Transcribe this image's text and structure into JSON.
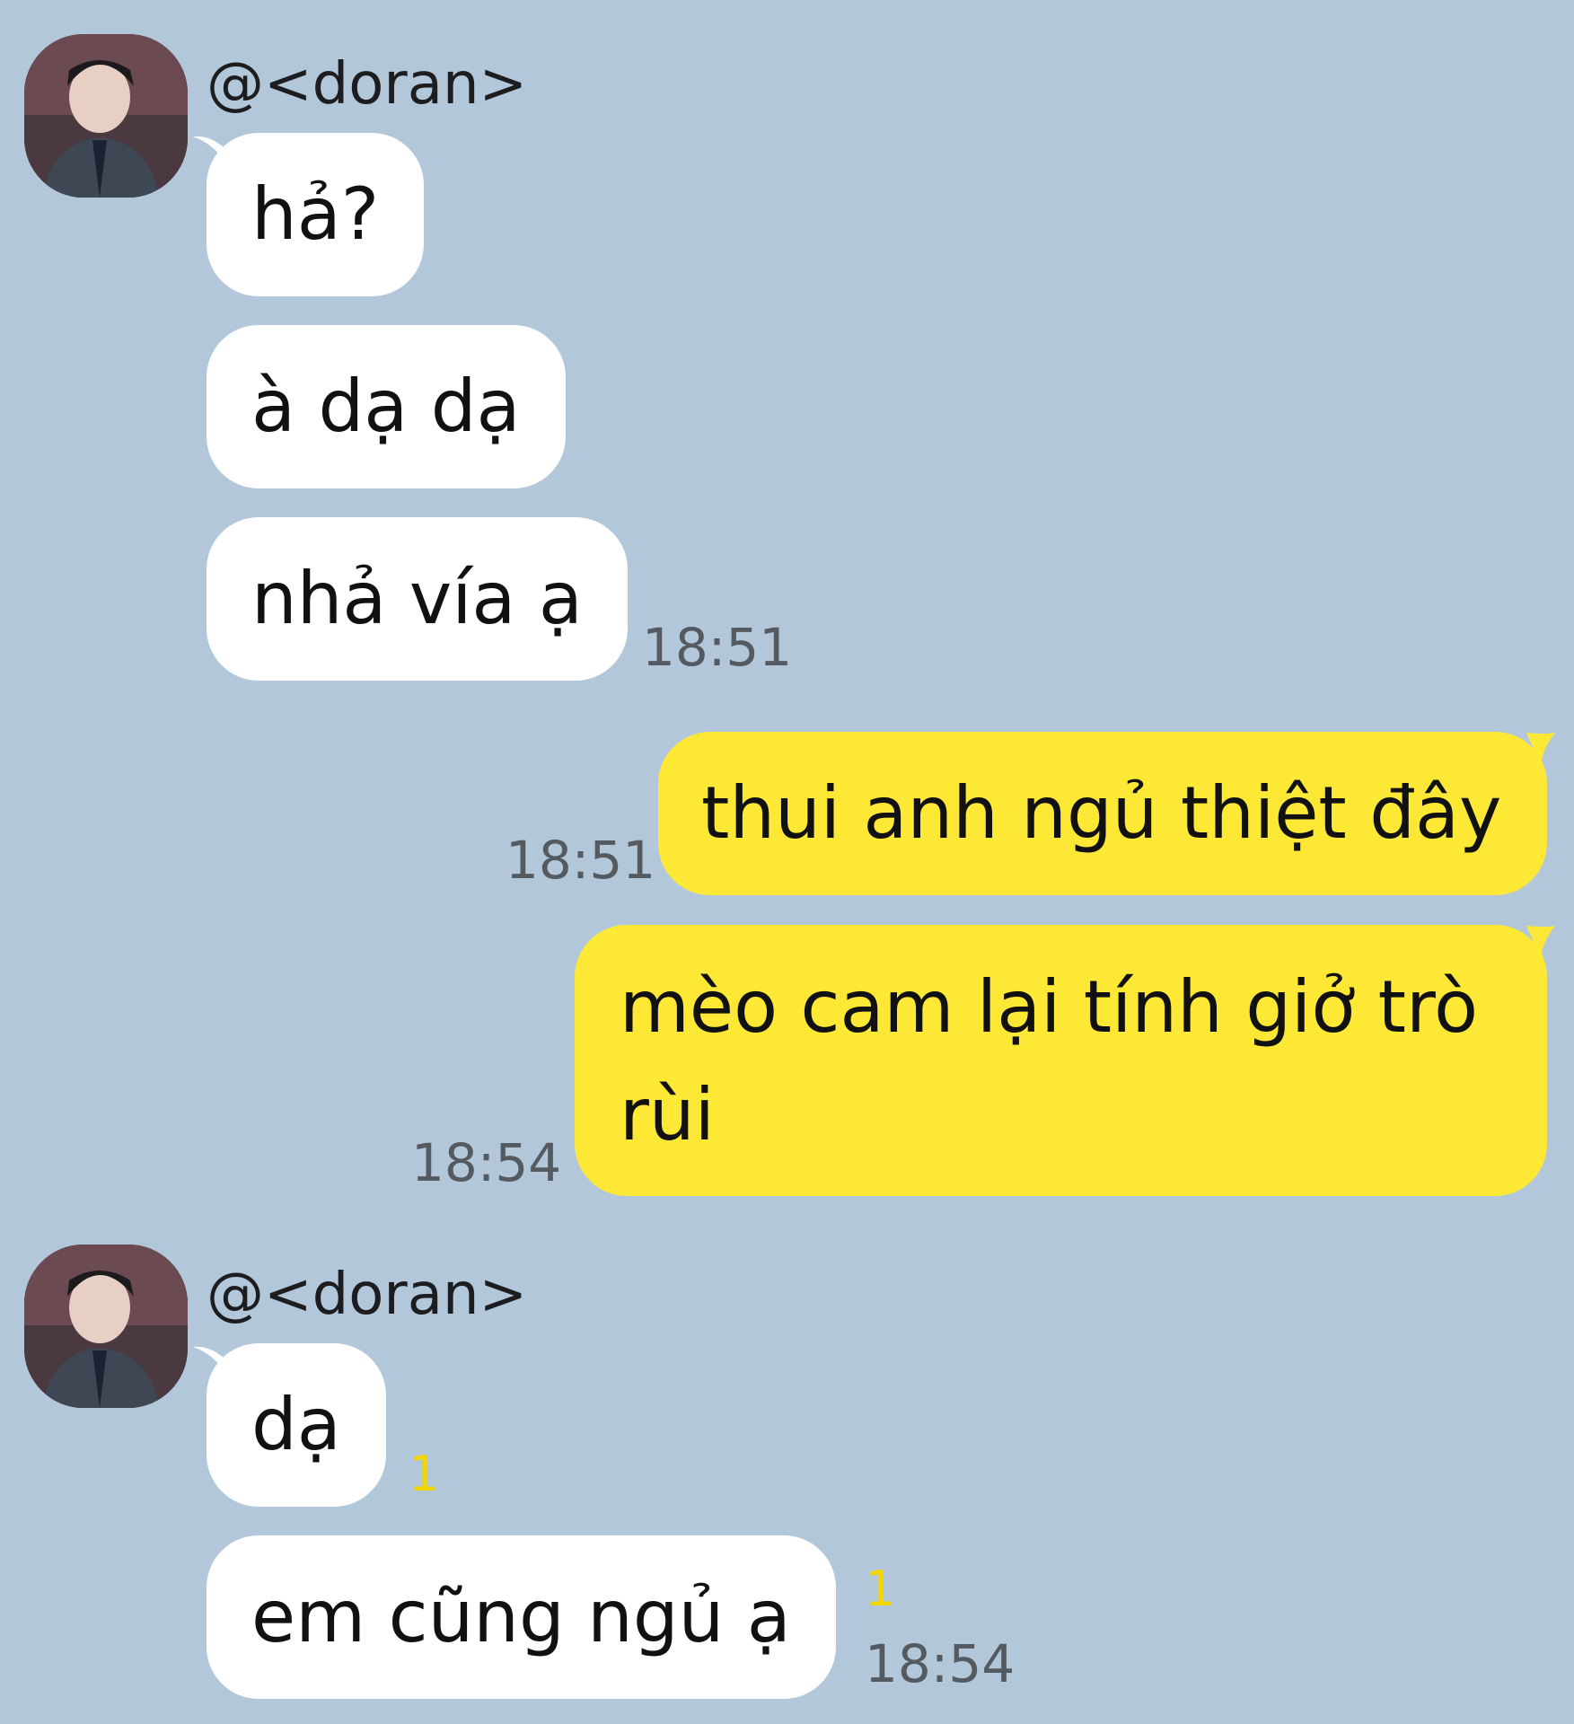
{
  "chat": {
    "groups": [
      {
        "sender": "@<doran>",
        "messages": [
          {
            "text": "hả?"
          },
          {
            "text": "à dạ dạ"
          },
          {
            "text": "nhả vía ạ",
            "time": "18:51"
          }
        ]
      },
      {
        "outgoing": [
          {
            "text": "thui anh ngủ thiệt đây",
            "time": "18:51"
          },
          {
            "text": "mèo cam lại tính giở trò rùi",
            "time": "18:54"
          }
        ]
      },
      {
        "sender": "@<doran>",
        "messages": [
          {
            "text": "dạ",
            "unread": "1"
          },
          {
            "text": "em cũng ngủ ạ",
            "unread": "1",
            "time": "18:54"
          }
        ]
      }
    ]
  },
  "colors": {
    "background": "#b2c7da",
    "incoming_bubble": "#ffffff",
    "outgoing_bubble": "#fee836",
    "unread_count": "#f2d600"
  }
}
